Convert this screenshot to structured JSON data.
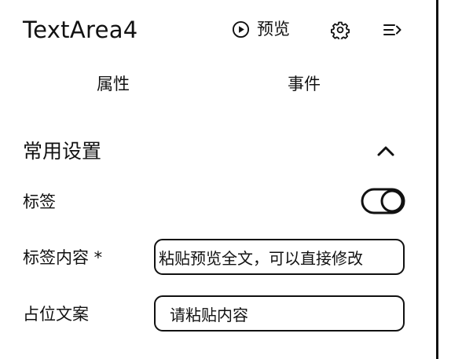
{
  "header": {
    "title": "TextArea4",
    "preview_label": "预览",
    "icons": {
      "preview": "play-circle-icon",
      "settings": "gear-icon",
      "collapse": "collapse-panel-icon"
    }
  },
  "tabs": [
    {
      "label": "属性"
    },
    {
      "label": "事件"
    }
  ],
  "section": {
    "title": "常用设置",
    "expanded": true,
    "icon": "chevron-up-icon"
  },
  "form": {
    "label_toggle": {
      "label": "标签",
      "enabled": true
    },
    "label_content": {
      "label": "标签内容 *",
      "value": "粘贴预览全文，可以直接修改"
    },
    "placeholder_text": {
      "label": "占位文案",
      "value": "请粘贴内容"
    }
  }
}
